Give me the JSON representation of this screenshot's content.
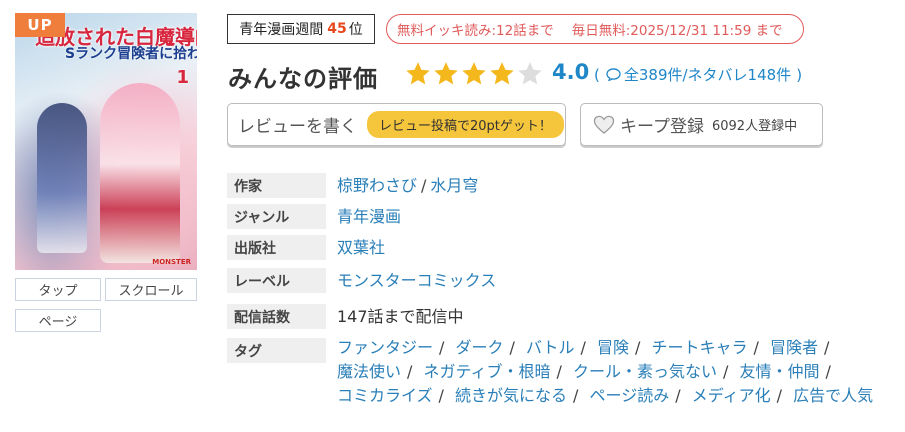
{
  "cover": {
    "badge": "UP",
    "title_main": "追放された白魔導師、",
    "title_sub": "Sランク冒険者に拾われる",
    "volume": "1"
  },
  "reading_modes": [
    "タップ",
    "スクロール",
    "ページ"
  ],
  "ranking": {
    "label": "青年漫画週間",
    "rank": "45",
    "unit": "位"
  },
  "free_info": {
    "ikki": "無料イッキ読み:12話まで",
    "daily": "毎日無料:2025/12/31 11:59 まで"
  },
  "evaluation": {
    "title": "みんなの評価",
    "score": "4.0",
    "rating": 4,
    "max_stars": 5,
    "counts_open": "(",
    "counts_text": "全389件/ネタバレ148件",
    "counts_close": ")"
  },
  "review_button": {
    "label": "レビューを書く",
    "promo": "レビュー投稿で20ptゲット！"
  },
  "keep_button": {
    "label": "キープ登録",
    "count": "6092人登録中"
  },
  "details": {
    "author_label": "作家",
    "authors": [
      "椋野わさび",
      "水月穹"
    ],
    "genre_label": "ジャンル",
    "genre": "青年漫画",
    "publisher_label": "出版社",
    "publisher": "双葉社",
    "label_label": "レーベル",
    "label": "モンスターコミックス",
    "episodes_label": "配信話数",
    "episodes": "147話まで配信中",
    "tags_label": "タグ"
  },
  "tags": [
    "ファンタジー",
    "ダーク",
    "バトル",
    "冒険",
    "チートキャラ",
    "冒険者",
    "魔法使い",
    "ネガティブ・根暗",
    "クール・素っ気ない",
    "友情・仲間",
    "コミカライズ",
    "続きが気になる",
    "ページ読み",
    "メディア化",
    "広告で人気"
  ],
  "colors": {
    "accent_blue": "#2a7fb8",
    "star": "#f5b81c",
    "rank_red": "#e8481c",
    "free_red": "#e05a5a",
    "promo_yellow": "#f5c53b",
    "badge_orange": "#ef7d3c"
  }
}
